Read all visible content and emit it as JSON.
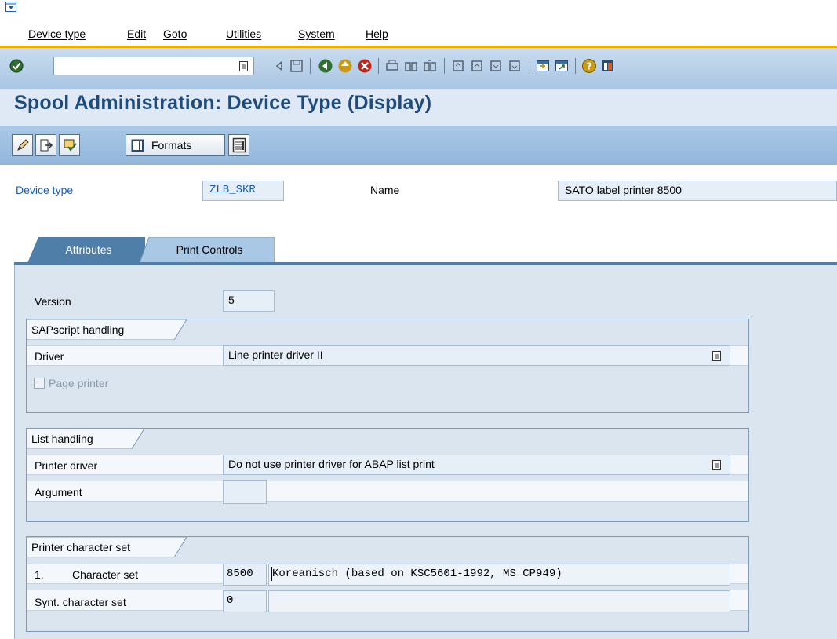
{
  "menu": [
    "Device type",
    "Edit",
    "Goto",
    "Utilities",
    "System",
    "Help"
  ],
  "toolbar": {
    "command_field_value": "",
    "icons": [
      "enter-icon",
      "back-icon",
      "save-icon",
      "back-nav-icon",
      "exit-icon",
      "cancel-icon",
      "print-icon",
      "find-icon",
      "find-next-icon",
      "first-page-icon",
      "previous-page-icon",
      "next-page-icon",
      "last-page-icon",
      "create-session-icon",
      "shortcut-icon",
      "help-icon",
      "customize-layout-icon"
    ]
  },
  "title": "Spool Administration: Device Type (Display)",
  "app_toolbar": {
    "formats_label": "Formats",
    "icons": [
      "display-change-icon",
      "other-object-icon",
      "check-icon",
      "formats-icon",
      "print-controls-icon"
    ]
  },
  "header": {
    "device_type_label": "Device type",
    "device_type_value": "ZLB_SKR",
    "name_label": "Name",
    "name_value": "SATO label printer 8500"
  },
  "tabs": [
    {
      "label": "Attributes",
      "active": true
    },
    {
      "label": "Print Controls",
      "active": false
    }
  ],
  "attributes": {
    "version_label": "Version",
    "version_value": "5",
    "sapscript": {
      "title": "SAPscript handling",
      "driver_label": "Driver",
      "driver_value": "Line printer driver II",
      "page_printer_label": "Page printer",
      "page_printer_checked": false
    },
    "list_handling": {
      "title": "List handling",
      "printer_driver_label": "Printer driver",
      "printer_driver_value": "Do not use printer driver for ABAP list print",
      "argument_label": "Argument",
      "argument_value": ""
    },
    "charset": {
      "title": "Printer character set",
      "row1_number": "1.",
      "row1_label": "Character set",
      "row1_code": "8500",
      "row1_desc": "Koreanisch (based on KSC5601-1992, MS CP949)",
      "row2_label": "Synt. character set",
      "row2_code": "0",
      "row2_desc": ""
    }
  },
  "colors": {
    "title": "#1f4b7a",
    "label_link": "#1a5fb4",
    "accent_line": "#f0ab00"
  }
}
